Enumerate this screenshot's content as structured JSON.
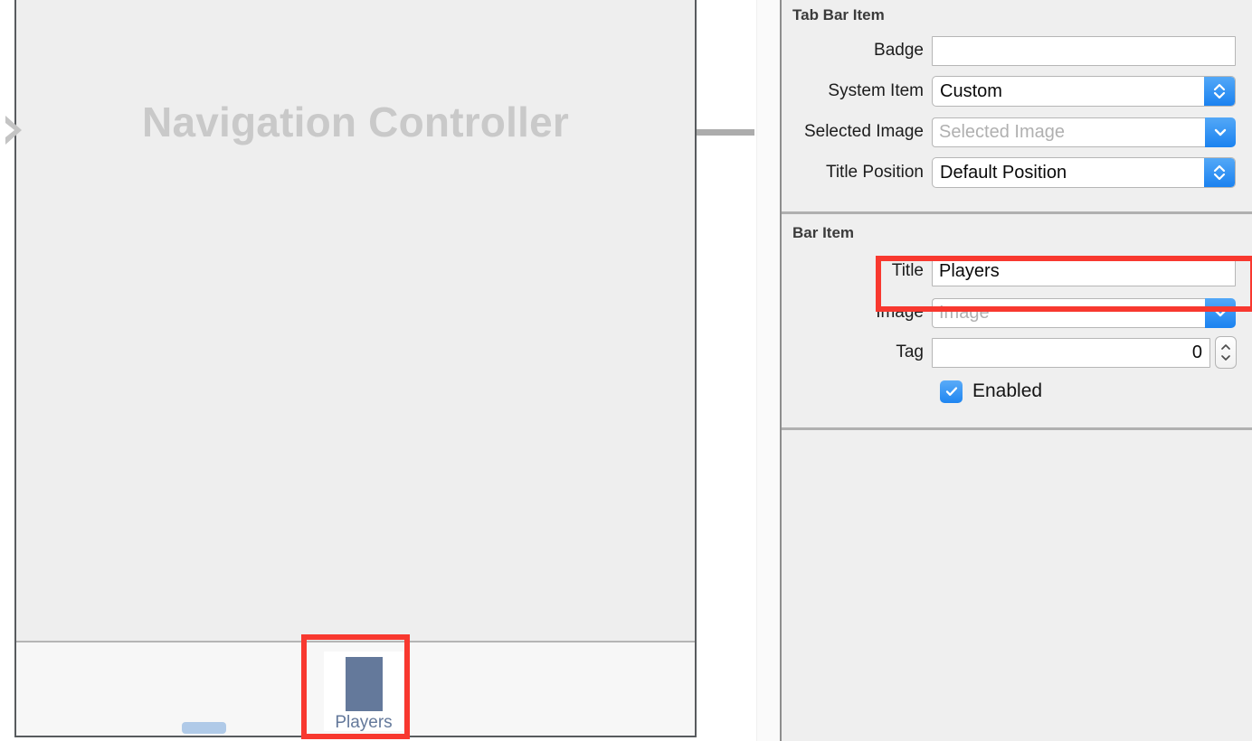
{
  "canvas": {
    "scene_title": "Navigation Controller",
    "entry_arrow_icon": "entry-point-arrow-icon",
    "tab_item": {
      "label": "Players",
      "glyph_icon": "tab-image-placeholder-icon",
      "glyph_color": "#64799b"
    },
    "ghost_tab_item_color": "#b0cae8"
  },
  "inspector": {
    "sections": [
      {
        "title": "Tab Bar Item",
        "rows": [
          {
            "label": "Badge",
            "value": "",
            "placeholder": "",
            "control": "textfield"
          },
          {
            "label": "System Item",
            "value": "Custom",
            "control": "popup"
          },
          {
            "label": "Selected Image",
            "value": "",
            "placeholder": "Selected Image",
            "control": "combo"
          },
          {
            "label": "Title Position",
            "value": "Default Position",
            "control": "popup"
          }
        ]
      },
      {
        "title": "Bar Item",
        "rows": [
          {
            "label": "Title",
            "value": "Players",
            "placeholder": "",
            "control": "textfield"
          },
          {
            "label": "Image",
            "value": "",
            "placeholder": "Image",
            "control": "combo"
          },
          {
            "label": "Tag",
            "value": "0",
            "control": "stepper"
          }
        ],
        "checkbox": {
          "label": "Enabled",
          "checked": true
        }
      }
    ]
  },
  "annotations": {
    "highlight_color": "#f8382f",
    "title_row_highlight": "Title",
    "tab_item_highlight": "Players"
  },
  "scrollbar": {
    "name": "canvas-vertical-scrollbar"
  }
}
